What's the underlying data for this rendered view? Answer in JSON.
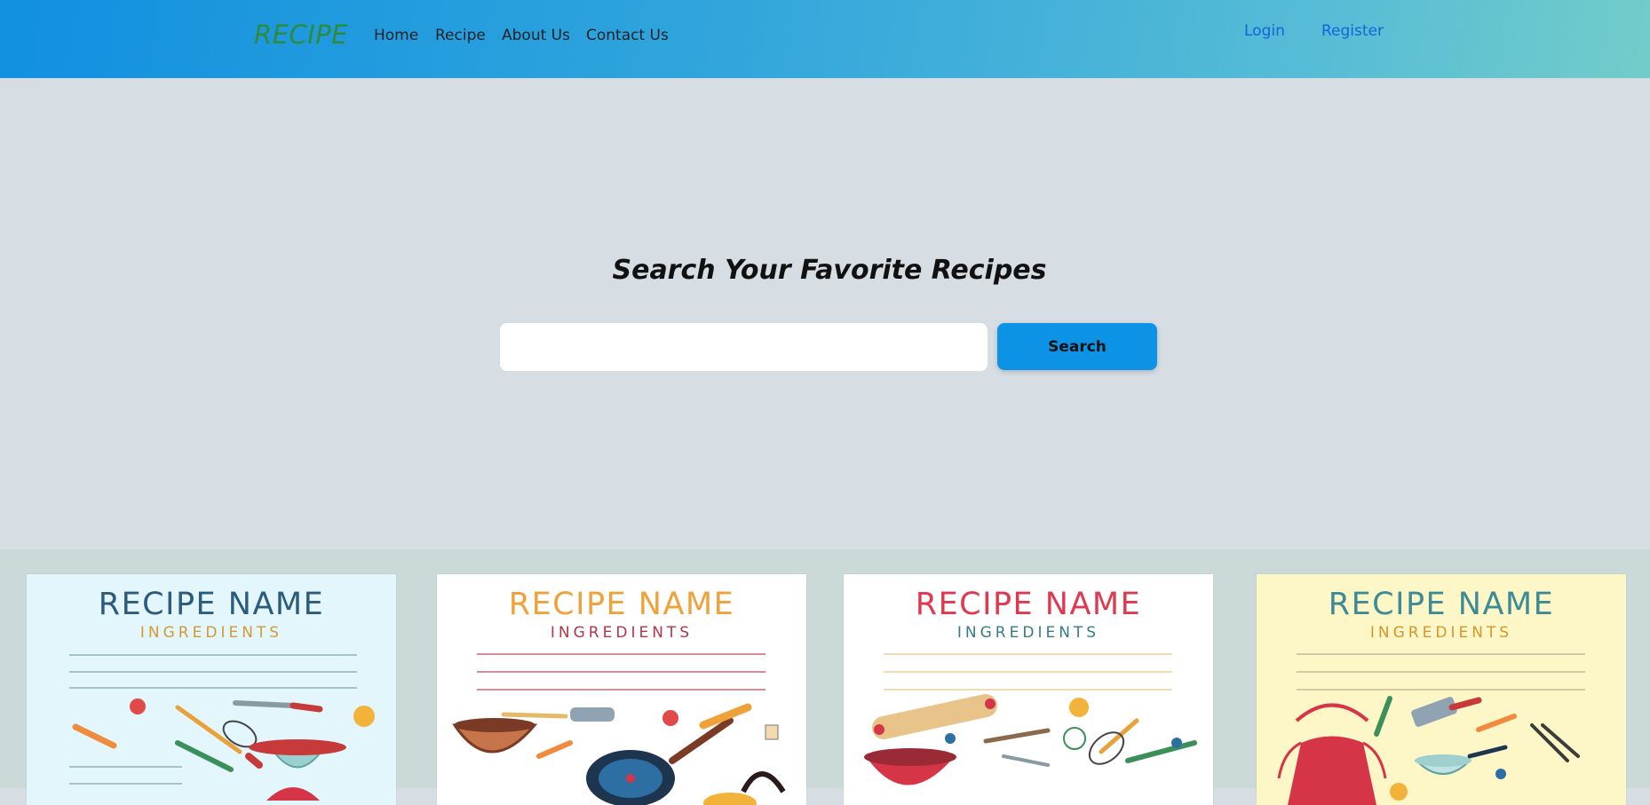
{
  "navbar": {
    "brand": "RECIPE",
    "links": [
      "Home",
      "Recipe",
      "About Us",
      "Contact Us"
    ],
    "login": "Login",
    "register": "Register"
  },
  "hero": {
    "title": "Search Your Favorite Recipes",
    "search_placeholder": "",
    "search_button": "Search"
  },
  "cards": [
    {
      "title": "RECIPE NAME",
      "subtitle": "INGREDIENTS",
      "bg": "#e3f6fb",
      "title_color": "#2b5c7e",
      "sub_color": "#d29a37",
      "line_color": "#7fa6a6"
    },
    {
      "title": "RECIPE NAME",
      "subtitle": "INGREDIENTS",
      "bg": "#ffffff",
      "title_color": "#f0a23a",
      "sub_color": "#b1374a",
      "line_color": "#b44a5a"
    },
    {
      "title": "RECIPE NAME",
      "subtitle": "INGREDIENTS",
      "bg": "#ffffff",
      "title_color": "#e0384f",
      "sub_color": "#3a7a88",
      "line_color": "#e6c58a"
    },
    {
      "title": "RECIPE NAME",
      "subtitle": "INGREDIENTS",
      "bg": "#fdf7c8",
      "title_color": "#3d8b96",
      "sub_color": "#d5962d",
      "line_color": "#b9b08a"
    }
  ],
  "colors": {
    "accent": "#0d93e6",
    "brand": "#2f8a3a",
    "auth_link": "#1463d8",
    "page_bg": "#d6dde3",
    "cards_bg": "#cbd9d8"
  }
}
